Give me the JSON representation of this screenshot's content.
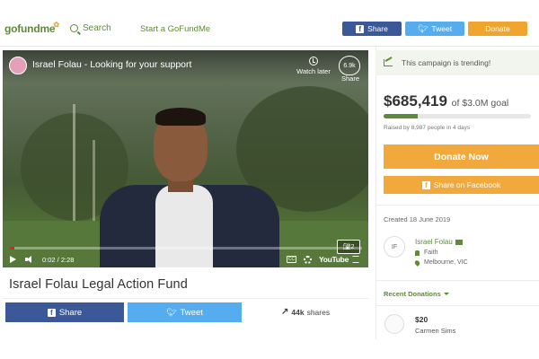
{
  "nav": {
    "logo_text": "gofundme",
    "search_label": "Search",
    "start_label": "Start a GoFundMe",
    "share_label": "Share",
    "tweet_label": "Tweet",
    "donate_label": "Donate"
  },
  "video": {
    "title": "Israel Folau - Looking for your support",
    "watch_later": "Watch later",
    "share": "Share",
    "heart_count": "6.9k",
    "time": "0:02 / 2:28",
    "progress_fraction": 0.014,
    "cc_label": "CC",
    "youtube_label": "YouTube",
    "photo_count": "2"
  },
  "campaign": {
    "title": "Israel Folau Legal Action Fund",
    "share_label": "Share",
    "tweet_label": "Tweet",
    "shares_count": "44k",
    "shares_label": "shares"
  },
  "sidebar": {
    "trending": "This campaign is trending!",
    "amount": "$685,419",
    "goal": "of $3.0M goal",
    "goal_fraction": 0.23,
    "raised_by": "Raised by 8,987 people in 4 days",
    "donate_label": "Donate Now",
    "fb_share_label": "Share on Facebook",
    "created": "Created 18 June 2019",
    "organizer_initials": "IF",
    "organizer_name": "Israel Folau",
    "category": "Faith",
    "location": "Melbourne, VIC",
    "recent_donations_label": "Recent Donations",
    "donation_amount": "$20",
    "donor_name": "Carmen Sims"
  },
  "colors": {
    "brand_green": "#5d8b38",
    "facebook": "#3b5998",
    "twitter": "#55acee",
    "donate_orange": "#f2a93b"
  }
}
